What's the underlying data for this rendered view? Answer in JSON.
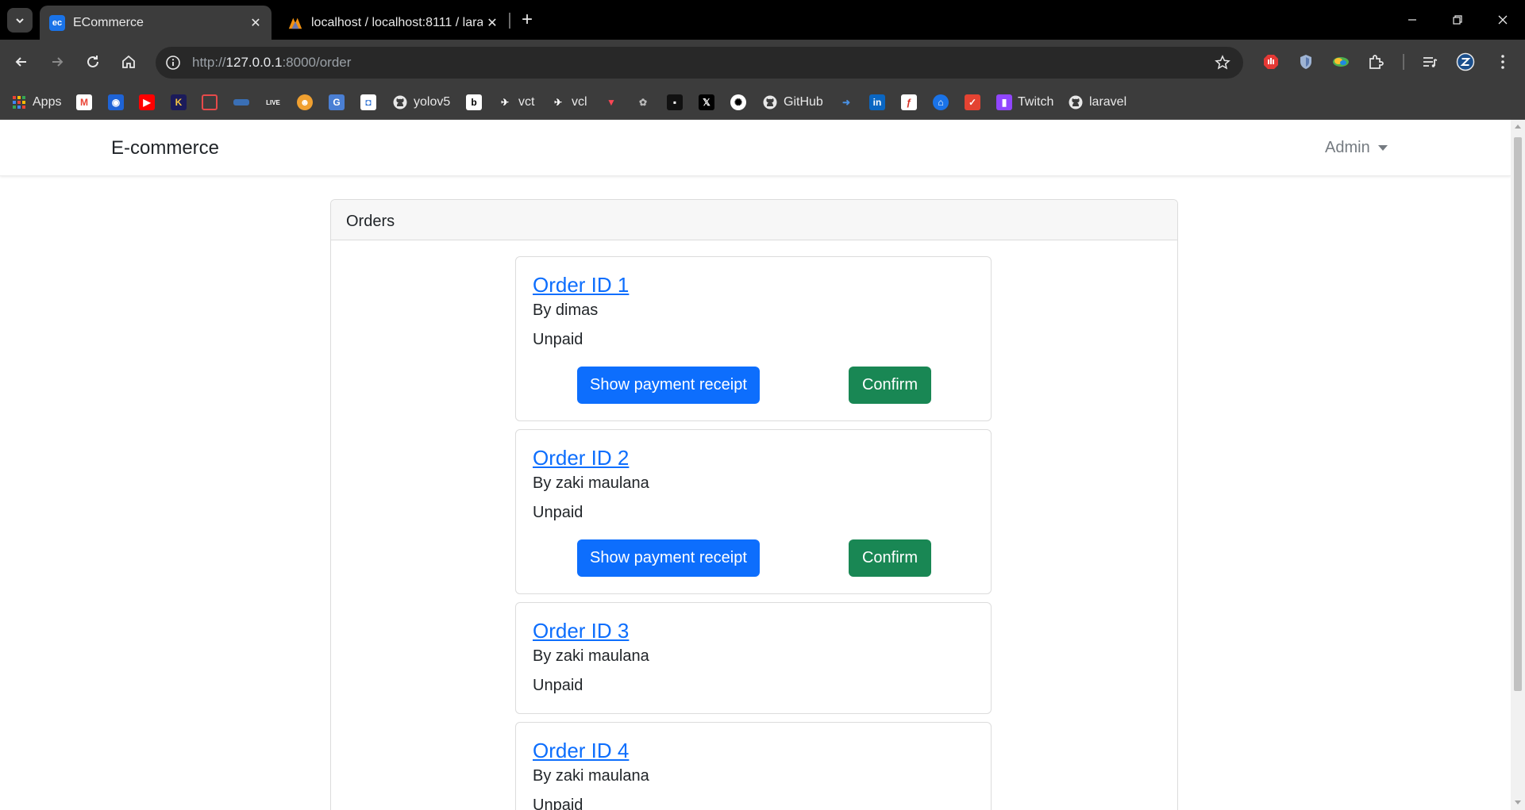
{
  "browser": {
    "tabs": [
      {
        "title": "ECommerce",
        "favicon": "ec-logo-icon"
      },
      {
        "title": "localhost / localhost:8111 / lara",
        "favicon": "phpmyadmin-icon"
      }
    ],
    "url_scheme": "http://",
    "url_host": "127.0.0.1",
    "url_path": ":8000/order",
    "bookmarks": [
      {
        "label": "Apps",
        "icon": "apps-grid-icon"
      },
      {
        "label": "yolov5",
        "icon": "github-icon"
      },
      {
        "label": "vct",
        "icon": "vct-icon"
      },
      {
        "label": "vcl",
        "icon": "vcl-icon"
      },
      {
        "label": "GitHub",
        "icon": "github-icon"
      },
      {
        "label": "Twitch",
        "icon": "twitch-icon"
      },
      {
        "label": "laravel",
        "icon": "github-icon"
      }
    ]
  },
  "navbar": {
    "brand": "E-commerce",
    "user_menu": "Admin"
  },
  "orders_panel": {
    "header": "Orders",
    "orders": [
      {
        "title": "Order ID 1",
        "by": "By dimas",
        "status": "Unpaid",
        "receipt_button": "Show payment receipt",
        "confirm_button": "Confirm"
      },
      {
        "title": "Order ID 2",
        "by": "By zaki maulana",
        "status": "Unpaid",
        "receipt_button": "Show payment receipt",
        "confirm_button": "Confirm"
      },
      {
        "title": "Order ID 3",
        "by": "By zaki maulana",
        "status": "Unpaid"
      },
      {
        "title": "Order ID 4",
        "by": "By zaki maulana",
        "status": "Unpaid"
      }
    ]
  },
  "colors": {
    "primary": "#0d6efd",
    "success": "#198754",
    "chrome_dark": "#3c3c3c"
  }
}
